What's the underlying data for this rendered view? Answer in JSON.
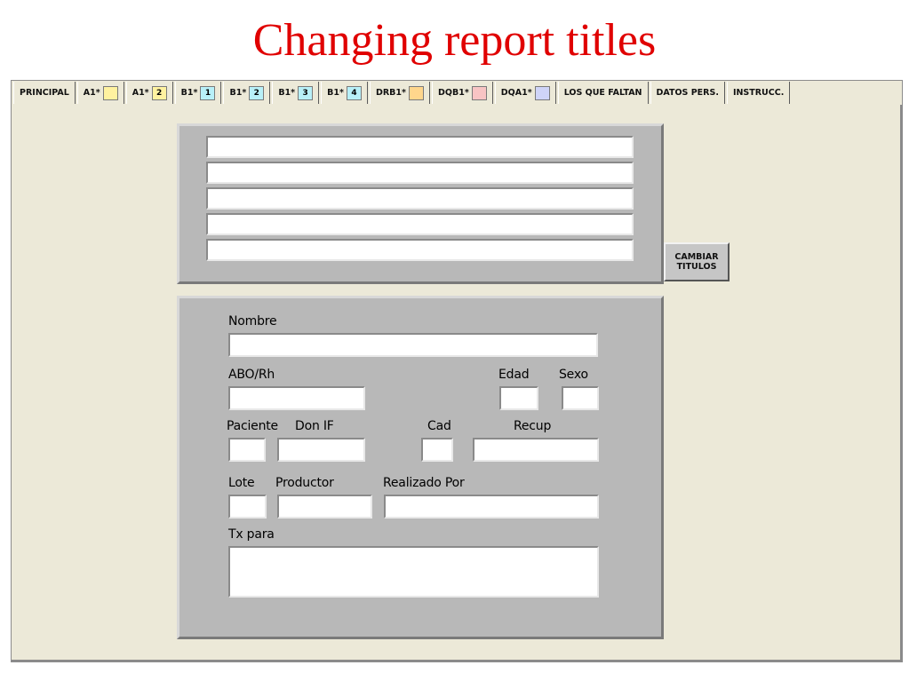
{
  "slide": {
    "title": "Changing report titles"
  },
  "tabs": [
    {
      "label": "PRINCIPAL"
    },
    {
      "label": "A1*",
      "swatch_color": "#fff2a0",
      "swatch_text": ""
    },
    {
      "label": "A1*",
      "swatch_color": "#fff2a0",
      "swatch_text": "2"
    },
    {
      "label": "B1*",
      "swatch_color": "#b8f0f8",
      "swatch_text": "1"
    },
    {
      "label": "B1*",
      "swatch_color": "#b8f0f8",
      "swatch_text": "2"
    },
    {
      "label": "B1*",
      "swatch_color": "#b8f0f8",
      "swatch_text": "3"
    },
    {
      "label": "B1*",
      "swatch_color": "#b8f0f8",
      "swatch_text": "4"
    },
    {
      "label": "DRB1*",
      "swatch_color": "#ffd68c",
      "swatch_text": ""
    },
    {
      "label": "DQB1*",
      "swatch_color": "#f8c4c4",
      "swatch_text": ""
    },
    {
      "label": "DQA1*",
      "swatch_color": "#cfd4f8",
      "swatch_text": ""
    },
    {
      "label": "LOS QUE FALTAN"
    },
    {
      "label": "DATOS PERS.",
      "active": true
    },
    {
      "label": "INSTRUCC."
    }
  ],
  "titles_panel": {
    "fields": [
      "",
      "",
      "",
      "",
      ""
    ],
    "button_label": "CAMBIAR\nTITULOS"
  },
  "form": {
    "nombre": {
      "label": "Nombre",
      "value": ""
    },
    "abo_rh": {
      "label": "ABO/Rh",
      "value": ""
    },
    "edad": {
      "label": "Edad",
      "value": ""
    },
    "sexo": {
      "label": "Sexo",
      "value": ""
    },
    "paciente": {
      "label": "Paciente",
      "value": ""
    },
    "don_if": {
      "label": "Don IF",
      "value": ""
    },
    "cad": {
      "label": "Cad",
      "value": ""
    },
    "recup": {
      "label": "Recup",
      "value": ""
    },
    "lote": {
      "label": "Lote",
      "value": ""
    },
    "productor": {
      "label": "Productor",
      "value": ""
    },
    "realizado_por": {
      "label": "Realizado Por",
      "value": ""
    },
    "tx_para": {
      "label": "Tx para",
      "value": ""
    }
  }
}
